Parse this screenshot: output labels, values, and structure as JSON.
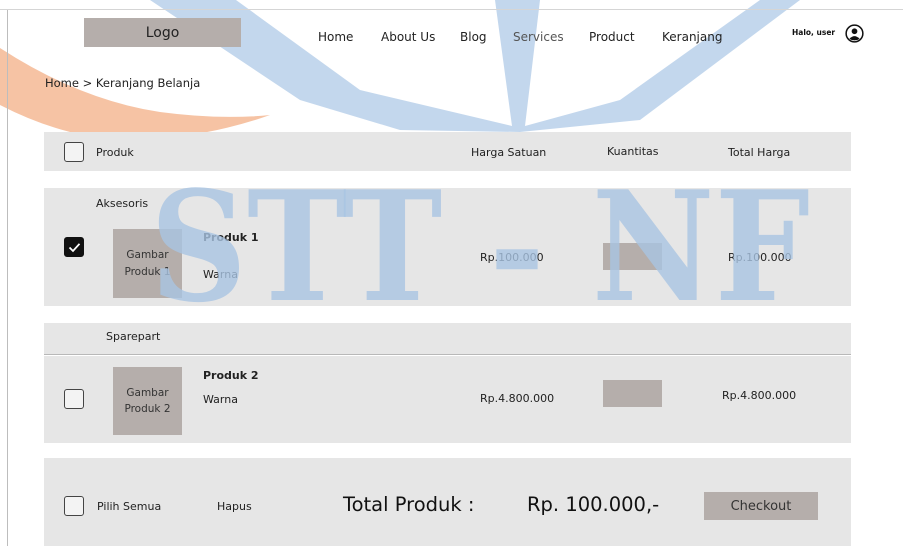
{
  "header": {
    "logo": "Logo",
    "nav": [
      "Home",
      "About Us",
      "Blog",
      "Services",
      "Product",
      "Keranjang"
    ],
    "user_greeting": "Halo, user",
    "user_icon": "user-circle-icon"
  },
  "breadcrumb": "Home > Keranjang Belanja",
  "table_header": {
    "product": "Produk",
    "unit_price": "Harga Satuan",
    "quantity": "Kuantitas",
    "total_price": "Total Harga"
  },
  "groups": [
    {
      "category": "Aksesoris",
      "items": [
        {
          "checked": true,
          "image_line1": "Gambar",
          "image_line2": "Produk 1",
          "name": "Produk 1",
          "variant": "Warna",
          "unit_price": "Rp.100.000",
          "total_price": "Rp.100.000"
        }
      ]
    },
    {
      "category": "Sparepart",
      "items": [
        {
          "checked": false,
          "image_line1": "Gambar",
          "image_line2": "Produk 2",
          "name": "Produk 2",
          "variant": "Warna",
          "unit_price": "Rp.4.800.000",
          "total_price": "Rp.4.800.000"
        }
      ]
    }
  ],
  "footer": {
    "select_all": "Pilih Semua",
    "delete": "Hapus",
    "total_label": "Total Produk :",
    "total_value": "Rp. 100.000,-",
    "checkout": "Checkout"
  },
  "watermark": "STT - NF",
  "colors": {
    "panel": "#e6e6e6",
    "placeholder": "#b5aeab",
    "watermark_blue": "#a9c4e2",
    "accent_orange": "#f2b08d"
  }
}
